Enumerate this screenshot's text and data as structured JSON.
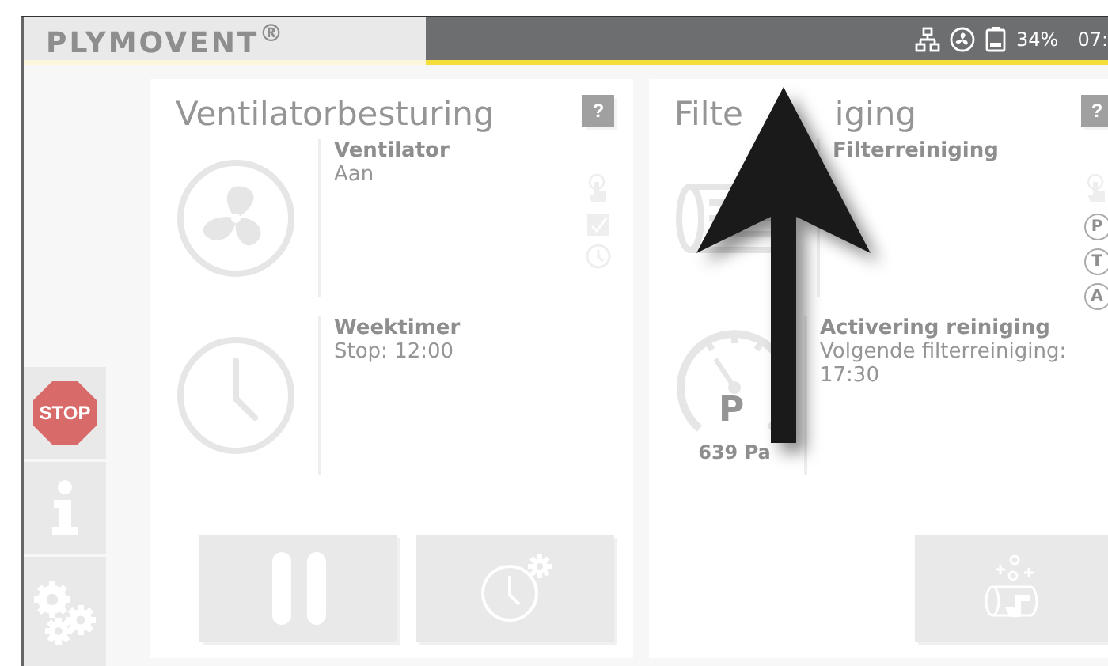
{
  "header": {
    "logo": "PLYMOVENT$^{®}$",
    "battery": "34%",
    "time": "07:"
  },
  "sidebar": [
    {
      "kind": "stop",
      "label": "STOP"
    },
    {
      "kind": "info"
    },
    {
      "kind": "settings"
    }
  ],
  "cards": [
    {
      "title": [
        "Ventilatorbesturing"
      ],
      "help": "?",
      "rows": [
        {
          "kind": "fan",
          "label": "Ventilator",
          "value": "Aan"
        },
        {
          "kind": "clock",
          "label": "Weektimer",
          "value": "Stop: 12:00"
        }
      ],
      "modes": [
        {
          "kind": "hand"
        },
        {
          "kind": "check"
        },
        {
          "kind": "clock"
        }
      ],
      "buttons": [
        {
          "kind": "pause"
        },
        {
          "kind": "timer"
        }
      ]
    },
    {
      "title": [
        "Filte",
        "iging"
      ],
      "help": "?",
      "rows": [
        {
          "kind": "filter",
          "label": "Filterreiniging"
        },
        {
          "kind": "gauge",
          "reading": "639 Pa",
          "gauge_letter": "P",
          "label": "Activering reiniging",
          "value": "Volgende filterreiniging: 17:30"
        }
      ],
      "modes": [
        {
          "kind": "hand"
        },
        {
          "kind": "letter",
          "text": "P"
        },
        {
          "kind": "letter",
          "text": "T"
        },
        {
          "kind": "letter",
          "text": "A"
        }
      ],
      "buttons": [
        {
          "kind": "clean"
        }
      ]
    }
  ]
}
